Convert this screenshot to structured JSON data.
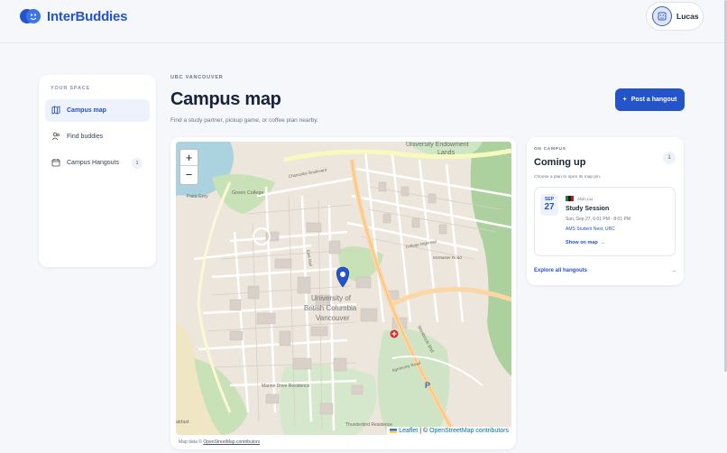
{
  "app": {
    "name": "InterBuddies",
    "brand_color": "#2454c8"
  },
  "user": {
    "name": "Lucas"
  },
  "sidebar": {
    "section_label": "YOUR SPACE",
    "items": [
      {
        "label": "Campus map",
        "icon": "map-icon",
        "active": true
      },
      {
        "label": "Find buddies",
        "icon": "users-icon",
        "active": false
      },
      {
        "label": "Campus Hangouts",
        "icon": "calendar-icon",
        "active": false,
        "badge": "1"
      }
    ]
  },
  "header": {
    "eyebrow": "UBC VANCOUVER",
    "title": "Campus map",
    "subtitle": "Find a study partner, pickup game, or coffee plan nearby.",
    "post_button": "Post a hangout"
  },
  "map": {
    "zoom_in": "+",
    "zoom_out": "−",
    "labels": {
      "endowment": "University Endowment",
      "lands": "Lands",
      "green_college": "Green College",
      "ubc1": "University of",
      "ubc2": "British Columbia",
      "ubc3": "Vancouver",
      "wesbrook_mall": "Wesbrook Mall",
      "chancellor": "Chancellor Boulevard",
      "mcmaster": "McMaster Road",
      "college_highroad": "College Highroad",
      "agronomy": "Agronomy Road",
      "east_mall": "East Mall",
      "marine": "Marine Drive Residence",
      "wakfast": "akfast",
      "thunderbird": "Thunderbird Residence",
      "point_grey": "Point Grey"
    },
    "attribution": {
      "leaflet": "Leaflet",
      "separator": " | © ",
      "osm": "OpenStreetMap contributors"
    },
    "credit_prefix": "Map data © ",
    "credit_link": "OpenStreetMap contributors"
  },
  "upcoming": {
    "eyebrow": "ON CAMPUS",
    "title": "Coming up",
    "count": "1",
    "hint": "Choose a plan to open its map pin.",
    "events": [
      {
        "month": "SEP",
        "day": "27",
        "host": "Alvin Liu",
        "title": "Study Session",
        "time": "Sun, Sep 27, 6:01 PM - 8:01 PM",
        "place": "AMS Student Nest, UBC",
        "action": "Show on map"
      }
    ],
    "explore": "Explore all hangouts"
  }
}
